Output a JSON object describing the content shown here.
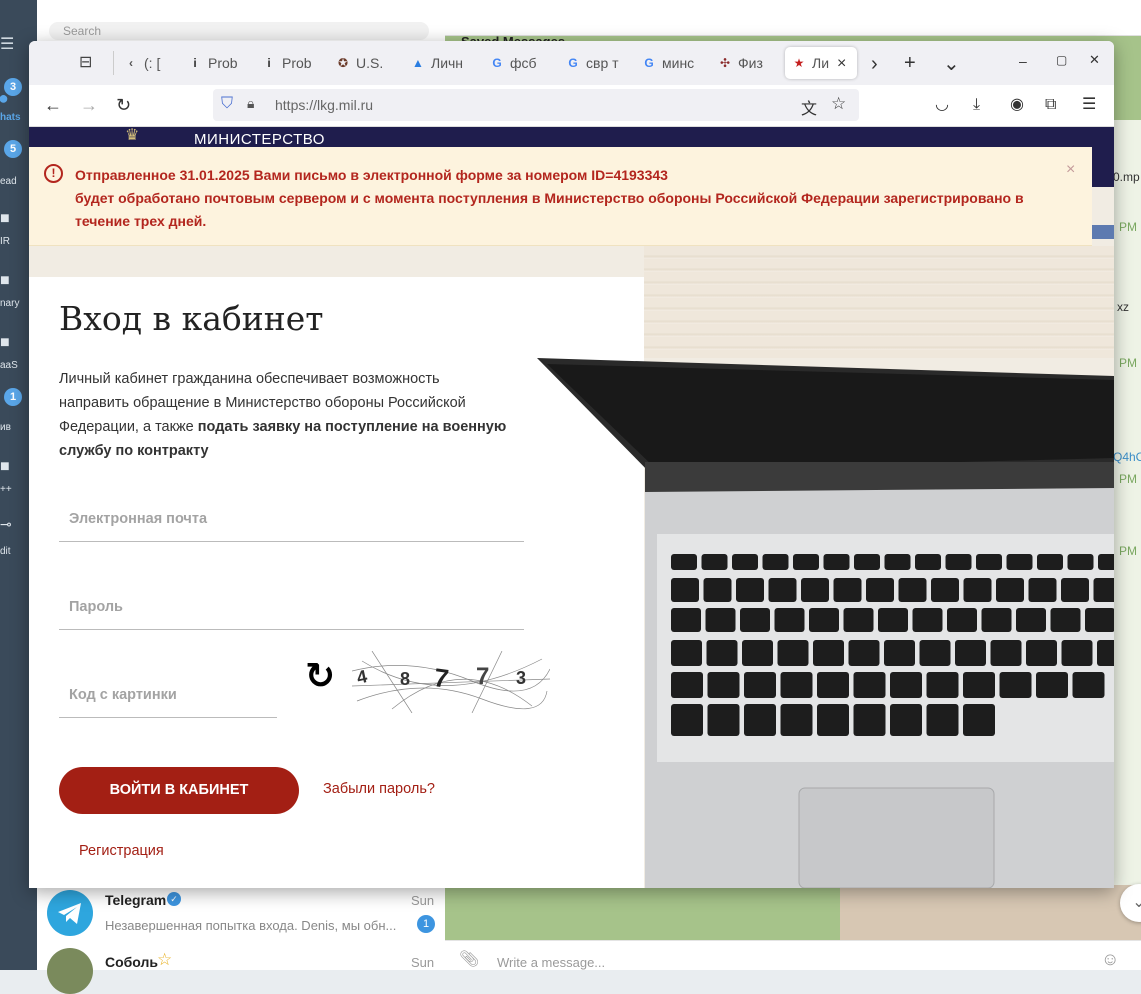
{
  "telegram": {
    "sidebar": [
      {
        "label": "hats",
        "badge": "3"
      },
      {
        "label": "ead",
        "badge": "5"
      },
      {
        "label": "IR",
        "badge": ""
      },
      {
        "label": "nary",
        "badge": ""
      },
      {
        "label": "aaS",
        "badge": ""
      },
      {
        "label": "ив",
        "badge": "1"
      },
      {
        "label": "++",
        "badge": ""
      },
      {
        "label": "dit",
        "badge": ""
      }
    ],
    "search_placeholder": "Search",
    "right_header": "Saved Messages",
    "chats": [
      {
        "name": "Telegram",
        "preview": "Незавершенная попытка входа. Denis, мы обн...",
        "time": "Sun",
        "unread": "1"
      },
      {
        "name": "Соболь",
        "preview": "",
        "time": "Sun",
        "unread": ""
      }
    ],
    "message_placeholder": "Write a message...",
    "right_fragments": [
      "0.mp",
      "PM",
      "xz",
      "PM",
      "Q4hC",
      "PM",
      "PM"
    ]
  },
  "browser": {
    "tabs": [
      {
        "label": "(: [",
        "icon": "‹"
      },
      {
        "label": "Prob",
        "icon": "i"
      },
      {
        "label": "Prob",
        "icon": "i"
      },
      {
        "label": "U.S.",
        "icon": "✪"
      },
      {
        "label": "Личн",
        "icon": "▲"
      },
      {
        "label": "фсб",
        "icon": "G"
      },
      {
        "label": "свр т",
        "icon": "G"
      },
      {
        "label": "минс",
        "icon": "G"
      },
      {
        "label": "Физ",
        "icon": "✣"
      },
      {
        "label": "Ли",
        "icon": "★"
      }
    ],
    "url": "https://lkg.mil.ru"
  },
  "page": {
    "header_title": "МИНИСТЕРСТВО",
    "banner": {
      "line1": "Отправленное 31.01.2025 Вами письмо в электронной форме за номером ID=4193343",
      "line2": "будет обработано почтовым сервером и с момента поступления в Министерство обороны Российской Федерации зарегистрировано в",
      "line3": "течение трех дней."
    },
    "login": {
      "title": "Вход в кабинет",
      "desc_plain1": "Личный кабинет гражданина обеспечивает возможность",
      "desc_plain2": "направить обращение в Министерство обороны Российской",
      "desc_plain3": "Федерации, а также ",
      "desc_bold1": "подать заявку на поступление на военную",
      "desc_bold2": "службу по контракту",
      "email_placeholder": "Электронная почта",
      "password_placeholder": "Пароль",
      "captcha_placeholder": "Код с картинки",
      "captcha_text": [
        "4",
        "8",
        "7",
        "7",
        "3"
      ],
      "submit": "ВОЙТИ В КАБИНЕТ",
      "forgot": "Забыли пароль?",
      "register": "Регистрация"
    }
  },
  "colors": {
    "brand_red": "#a31f14",
    "banner_text": "#b3261e",
    "banner_bg": "#fdf3de",
    "header_navy": "#1f1d4d"
  }
}
